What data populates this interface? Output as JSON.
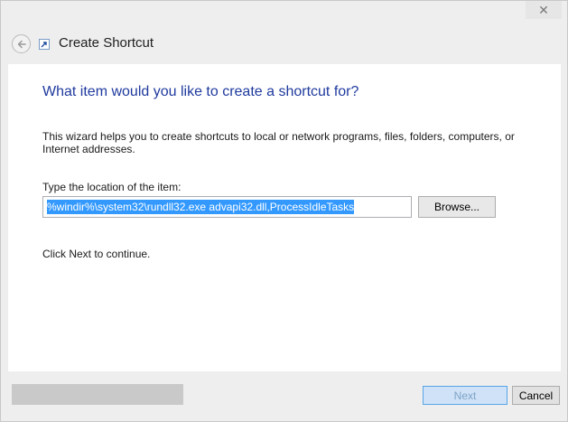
{
  "window": {
    "title": "Create Shortcut",
    "close_glyph": "✕"
  },
  "icons": {
    "back": "back-arrow-icon",
    "shortcut": "shortcut-icon",
    "close": "close-icon"
  },
  "main": {
    "heading": "What item would you like to create a shortcut for?",
    "description": "This wizard helps you to create shortcuts to local or network programs, files, folders, computers, or Internet addresses.",
    "location_label": "Type the location of the item:",
    "location_value": "%windir%\\system32\\rundll32.exe advapi32.dll,ProcessIdleTasks",
    "browse_label": "Browse...",
    "continue_text": "Click Next to continue."
  },
  "footer": {
    "next_label": "Next",
    "cancel_label": "Cancel"
  },
  "colors": {
    "heading": "#1f3a9e",
    "selection": "#3399ff",
    "next_border": "#57a5e6"
  }
}
